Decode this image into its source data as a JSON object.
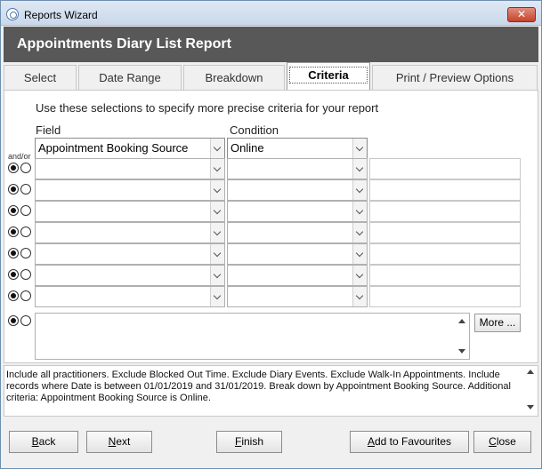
{
  "window": {
    "title": "Reports Wizard",
    "close_glyph": "✕"
  },
  "header": {
    "title": "Appointments Diary List Report"
  },
  "tabs": [
    {
      "label": "Select"
    },
    {
      "label": "Date Range"
    },
    {
      "label": "Breakdown"
    },
    {
      "label": "Criteria",
      "active": true
    },
    {
      "label": "Print / Preview Options"
    }
  ],
  "criteria": {
    "intro": "Use these selections to specify more precise criteria for your report",
    "field_label": "Field",
    "condition_label": "Condition",
    "andor_label": "and/or",
    "first_row": {
      "field": "Appointment Booking Source",
      "condition": "Online"
    },
    "more_button": "More ..."
  },
  "summary": "Include all practitioners. Exclude Blocked Out Time. Exclude Diary Events. Exclude Walk-In Appointments. Include records where Date is between 01/01/2019 and 31/01/2019. Break down by Appointment Booking Source. Additional criteria: Appointment Booking Source is Online.",
  "buttons": {
    "back_u": "B",
    "back": "ack",
    "next_u": "N",
    "next": "ext",
    "finish_u": "F",
    "finish": "inish",
    "favourites_u": "A",
    "favourites": "dd to Favourites",
    "close_u": "C",
    "close": "lose"
  }
}
